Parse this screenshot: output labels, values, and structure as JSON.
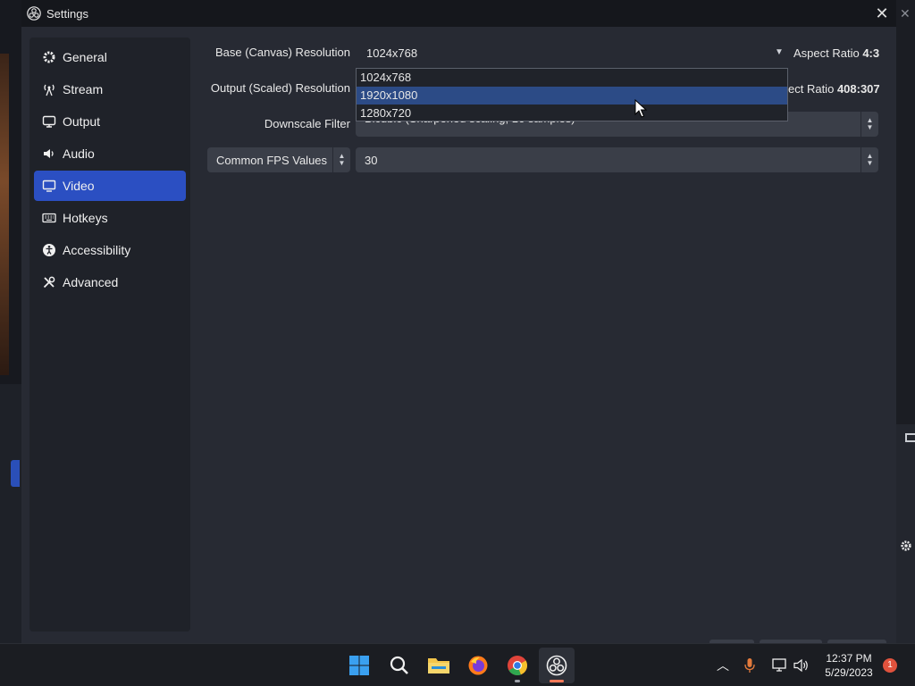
{
  "window": {
    "title": "Settings",
    "close_glyph": "✕"
  },
  "sidebar": {
    "items": [
      {
        "label": "General",
        "icon": "gear-icon"
      },
      {
        "label": "Stream",
        "icon": "antenna-icon"
      },
      {
        "label": "Output",
        "icon": "monitor-out-icon"
      },
      {
        "label": "Audio",
        "icon": "speaker-icon"
      },
      {
        "label": "Video",
        "icon": "monitor-icon",
        "active": true
      },
      {
        "label": "Hotkeys",
        "icon": "keyboard-icon"
      },
      {
        "label": "Accessibility",
        "icon": "accessibility-icon"
      },
      {
        "label": "Advanced",
        "icon": "tools-icon"
      }
    ]
  },
  "video": {
    "base_label": "Base (Canvas) Resolution",
    "base_value": "1024x768",
    "base_aspect_prefix": "Aspect Ratio",
    "base_aspect_value": "4:3",
    "output_label": "Output (Scaled) Resolution",
    "output_aspect_prefix": "ect Ratio",
    "output_aspect_value": "408:307",
    "downscale_label": "Downscale Filter",
    "downscale_value": "Bicubic (Sharpened scaling, 16 samples)",
    "fps_type_value": "Common FPS Values",
    "fps_value": "30"
  },
  "dropdown": {
    "options": [
      "1024x768",
      "1920x1080",
      "1280x720"
    ],
    "highlighted_index": 1
  },
  "taskbar": {
    "time": "12:37 PM",
    "date": "5/29/2023",
    "notification_count": "1"
  },
  "colors": {
    "accent": "#2b4fc2",
    "dialog_bg": "#272a33",
    "sidebar_bg": "#1f2229",
    "taskbar_bg": "#1b1d22"
  }
}
